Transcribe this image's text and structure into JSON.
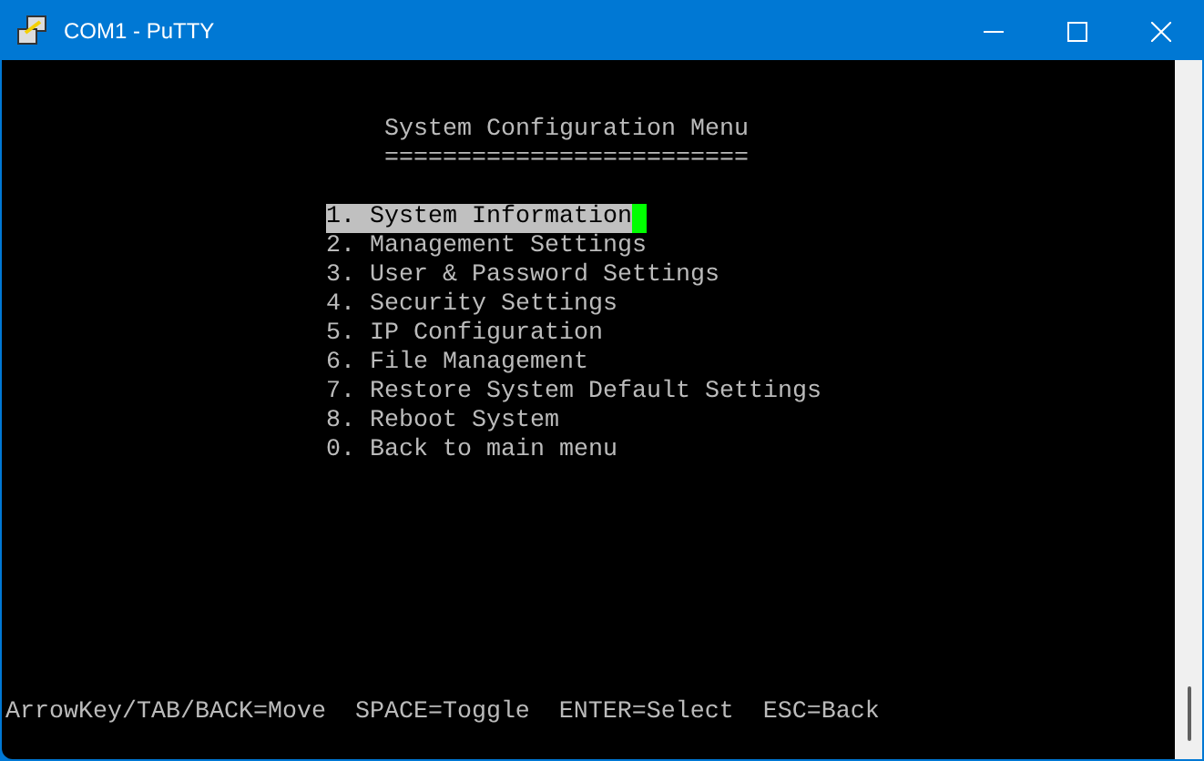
{
  "window": {
    "title": "COM1 - PuTTY"
  },
  "terminal": {
    "title": "System Configuration Menu",
    "underline": "=========================",
    "items": [
      {
        "label": "1. System Information",
        "selected": true
      },
      {
        "label": "2. Management Settings",
        "selected": false
      },
      {
        "label": "3. User & Password Settings",
        "selected": false
      },
      {
        "label": "4. Security Settings",
        "selected": false
      },
      {
        "label": "5. IP Configuration",
        "selected": false
      },
      {
        "label": "6. File Management",
        "selected": false
      },
      {
        "label": "7. Restore System Default Settings",
        "selected": false
      },
      {
        "label": "8. Reboot System",
        "selected": false
      },
      {
        "label": "0. Back to main menu",
        "selected": false
      }
    ],
    "footer": "ArrowKey/TAB/BACK=Move  SPACE=Toggle  ENTER=Select  ESC=Back"
  }
}
